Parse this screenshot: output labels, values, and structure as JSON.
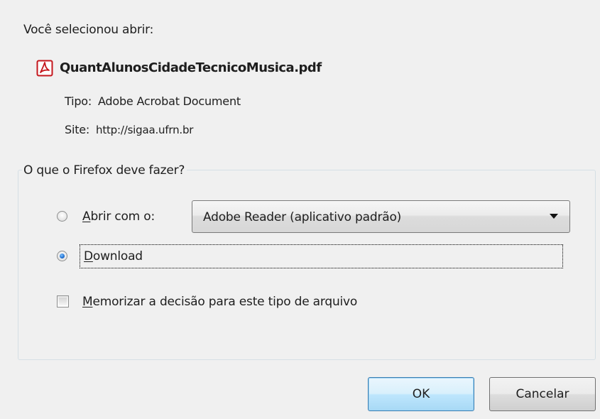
{
  "intro": "Você selecionou abrir:",
  "file": {
    "icon": "pdf-file-icon",
    "name": "QuantAlunosCidadeTecnicoMusica.pdf",
    "type_label": "Tipo:",
    "type_value": "Adobe Acrobat Document",
    "site_label": "Site:",
    "site_value": "http://sigaa.ufrn.br"
  },
  "action_group": {
    "legend": "O que o Firefox deve fazer?",
    "open_with": {
      "mnemonic": "A",
      "label_rest": "brir com o:",
      "checked": false
    },
    "application_select": {
      "value": "Adobe Reader  (aplicativo padrão)"
    },
    "download": {
      "mnemonic": "D",
      "label_rest": "ownload",
      "checked": true
    },
    "remember": {
      "mnemonic": "M",
      "label_rest": "emorizar a decisão para este tipo de arquivo",
      "checked": false
    }
  },
  "buttons": {
    "ok": "OK",
    "cancel": "Cancelar"
  },
  "colors": {
    "dialog_bg": "#f0f0f0",
    "ok_border": "#3c7fb1",
    "pdf_red": "#c4161c"
  }
}
